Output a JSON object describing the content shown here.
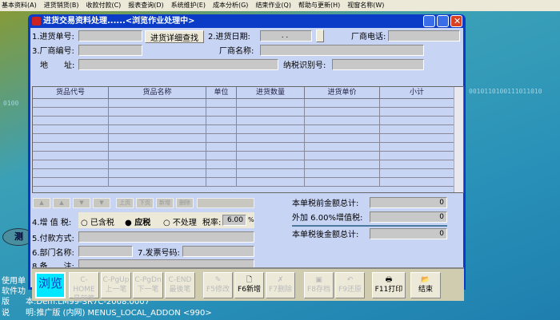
{
  "menu": [
    "基本资料(A)",
    "进货销货(B)",
    "收款付款(C)",
    "报表查询(D)",
    "系统维护(E)",
    "成本分析(G)",
    "结束作业(Q)",
    "帮助与更新(H)",
    "视窗名称(W)"
  ],
  "desktop": {
    "oval": "测",
    "line1": "使用单",
    "line2": "软件功",
    "line3_label": "版　　本:",
    "line3": "Dem.LM99-SR7C-2008.0007",
    "line4_label": "说　　明:",
    "line4": "推广版 (内网) MENUS_LOCAL_ADDON <990>",
    "bin_left": "0100",
    "bin_right": "0010110100111011010"
  },
  "window": {
    "title": "进货交易资料处理......<浏览作业处理中>"
  },
  "form": {
    "order_no": "1.进货单号:",
    "detail_btn": "进货详细查找",
    "date": "2.进货日期:",
    "date_val": ".  .",
    "vendor_phone": "厂商电话:",
    "vendor_no": "3.厂商编号:",
    "vendor_name": "厂商名称:",
    "address": "地　　址:",
    "tax_id": "纳税识别号:"
  },
  "grid": {
    "columns": [
      "货品代号",
      "货品名称",
      "单位",
      "进货数量",
      "进货单价",
      "小计"
    ]
  },
  "nav": {
    "prev_page": "上页",
    "next_page": "下页",
    "add": "新增",
    "delete": "删除"
  },
  "tax": {
    "label": "4.增 值 税:",
    "opt1": "已含税",
    "opt2": "应税",
    "opt3": "不处理",
    "rate_label": "税率:",
    "rate": "6.00",
    "pct": "%",
    "selected": "应税"
  },
  "payment": "5.付款方式:",
  "dept": "6.部门名称:",
  "invoice": "7.发票号码:",
  "note": "8.备　　注:",
  "totals": {
    "pre_label": "本单税前金额总计:",
    "pre": "0",
    "vat_label": "外加 6.00%增值税:",
    "vat": "0",
    "post_label": "本单税後金额总计:",
    "post": "0"
  },
  "toolbar": {
    "browse": "浏览",
    "first": [
      "C-HOME",
      "最前笔"
    ],
    "prev": [
      "C-PgUp",
      "上一笔"
    ],
    "next": [
      "C-PgDn",
      "下一笔"
    ],
    "last": [
      "C-END",
      "最後笔"
    ],
    "edit": "F5修改",
    "new": "F6新增",
    "del": "F7删除",
    "save": "F8存档",
    "undo": "F9还原",
    "print": "F11打印",
    "end": "结束"
  }
}
